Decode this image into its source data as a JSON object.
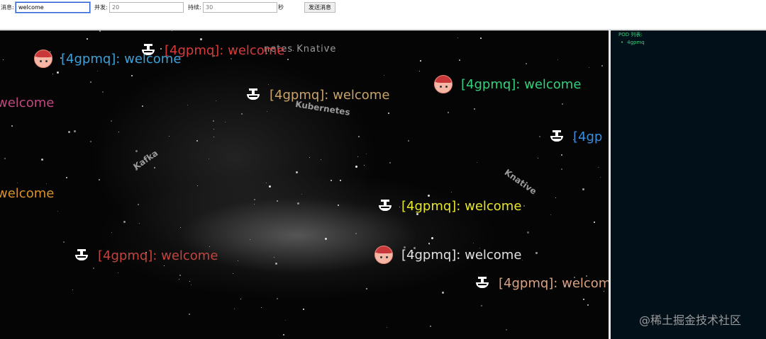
{
  "toolbar": {
    "message_label": "消息:",
    "message_value": "welcome",
    "concurrency_label": "并发:",
    "concurrency_placeholder": "20",
    "duration_label": "持续:",
    "duration_placeholder": "30",
    "duration_unit": "秒",
    "send_button": "发送消息"
  },
  "stage": {
    "background_labels": {
      "top": "netes Knative",
      "kubernetes": "Kubernetes",
      "kafka": "Kafka",
      "knative": "Knative"
    },
    "messages": [
      {
        "icon": "avatar-icon",
        "text": "[4gpmq]: welcome",
        "color": "#3ea0d8"
      },
      {
        "icon": "boat-icon",
        "text": "[4gpmq]: welcome",
        "color": "#d63a3a"
      },
      {
        "icon": "avatar-icon",
        "text": "[4gpmq]: welcome",
        "color": "#33d17a"
      },
      {
        "icon": "",
        "text": "welcome",
        "color": "#c04880"
      },
      {
        "icon": "boat-icon",
        "text": "[4gpmq]: welcome",
        "color": "#c9a36a"
      },
      {
        "icon": "boat-icon",
        "text": "[4gp",
        "color": "#3a8ee0"
      },
      {
        "icon": "",
        "text": "welcome",
        "color": "#d9922a"
      },
      {
        "icon": "boat-icon",
        "text": "[4gpmq]: welcome",
        "color": "#e6e62a"
      },
      {
        "icon": "boat-icon",
        "text": "[4gpmq]: welcome",
        "color": "#c0453f"
      },
      {
        "icon": "avatar-icon",
        "text": "[4gpmq]: welcome",
        "color": "#e0e0e0"
      },
      {
        "icon": "boat-icon",
        "text": "[4gpmq]: welcom",
        "color": "#d9a282"
      }
    ]
  },
  "sidebar": {
    "title": "POD 列表:",
    "items": [
      "4gpmq"
    ]
  },
  "watermark": "@稀土掘金技术社区"
}
